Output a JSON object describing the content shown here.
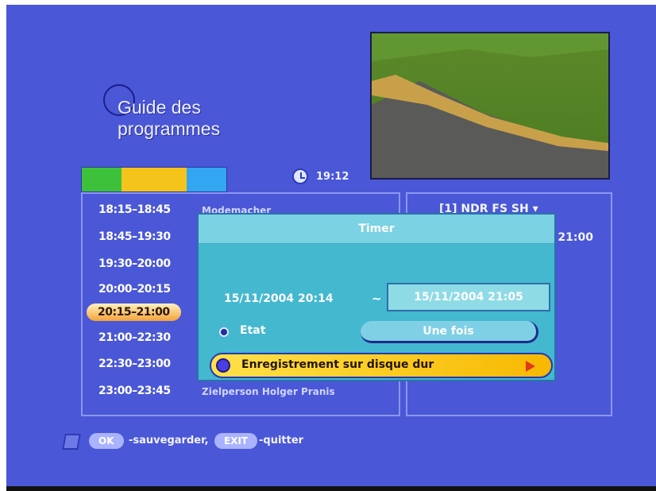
{
  "header": {
    "title_line1": "Guide des",
    "title_line2": "programmes",
    "clock": "19:12"
  },
  "color_bar": [
    "#3ec13a",
    "#f5c41a",
    "#32a6f0"
  ],
  "program_list": [
    {
      "time": "18:15–18:45",
      "title": "Modemacher"
    },
    {
      "time": "18:45–19:30",
      "title": ""
    },
    {
      "time": "19:30–20:00",
      "title": ""
    },
    {
      "time": "20:00–20:15",
      "title": ""
    },
    {
      "time": "20:15–21:00",
      "title": "",
      "selected": true
    },
    {
      "time": "21:00–22:30",
      "title": ""
    },
    {
      "time": "22:30–23:00",
      "title": ""
    },
    {
      "time": "23:00–23:45",
      "title": "Zielperson Holger Pranis"
    }
  ],
  "channel_panel": {
    "channel": "[1]   NDR FS SH ▾",
    "time": "21:00"
  },
  "timer_dialog": {
    "title": "Timer",
    "start": "15/11/2004 20:14",
    "separator": "~",
    "end": "15/11/2004 21:05",
    "state_label": "Etat",
    "state_value": "Une fois",
    "record_label": "Enregistrement sur disque dur"
  },
  "footer": {
    "ok_key": "OK",
    "ok_desc": "-sauvegarder,",
    "exit_key": "EXIT",
    "exit_desc": "-quitter"
  }
}
